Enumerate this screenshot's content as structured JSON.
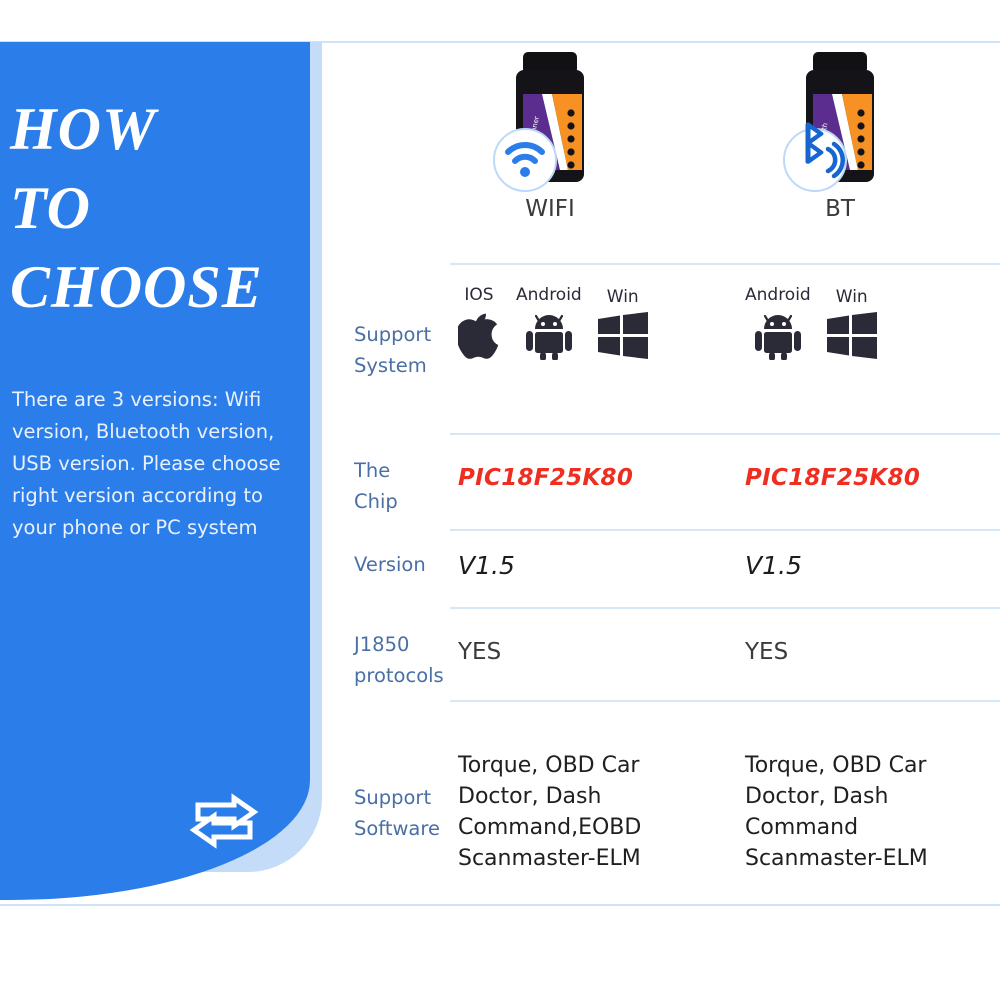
{
  "hero": {
    "title_lines": [
      "HOW",
      "TO",
      "CHOOSE"
    ],
    "title": "HOW TO CHOOSE",
    "body": "There are 3 versions: Wifi version, Bluetooth version, USB version. Please choose right version according to your phone or PC system",
    "icon": "exchange-arrows-icon",
    "bg_color": "#2b7de9",
    "shadow_color": "#c5dcf8",
    "title_color": "#ffffff",
    "body_color": "#e9f1fd"
  },
  "table": {
    "divider_color": "#d6e7f8",
    "label_color": "#4a6fa5",
    "products": [
      {
        "label": "WIFI",
        "badge_icon": "wifi-icon"
      },
      {
        "label": "BT",
        "badge_icon": "bluetooth-icon"
      }
    ],
    "rows": [
      {
        "label_lines": [
          "Support",
          "System"
        ],
        "label": "Support System",
        "type": "os",
        "values": [
          {
            "systems": [
              {
                "name": "IOS",
                "icon": "apple-icon"
              },
              {
                "name": "Android",
                "icon": "android-icon"
              },
              {
                "name": "Win",
                "icon": "windows-icon"
              }
            ]
          },
          {
            "systems": [
              {
                "name": "Android",
                "icon": "android-icon"
              },
              {
                "name": "Win",
                "icon": "windows-icon"
              }
            ]
          }
        ]
      },
      {
        "label_lines": [
          "The",
          "Chip"
        ],
        "label": "The Chip",
        "type": "chip",
        "values": [
          "PIC18F25K80",
          "PIC18F25K80"
        ],
        "value_color": "#ef2e22"
      },
      {
        "label_lines": [
          "Version"
        ],
        "label": "Version",
        "type": "version",
        "values": [
          "V1.5",
          "V1.5"
        ]
      },
      {
        "label_lines": [
          "J1850",
          "protocols"
        ],
        "label": "J1850 protocols",
        "type": "yesno",
        "values": [
          "YES",
          "YES"
        ]
      },
      {
        "label_lines": [
          "Support",
          "Software"
        ],
        "label": "Support Software",
        "type": "software",
        "values": [
          [
            "Torque, OBD Car",
            "Doctor, Dash",
            "Command,EOBD",
            "Scanmaster-ELM"
          ],
          [
            "Torque, OBD Car",
            "Doctor, Dash",
            "Command",
            "Scanmaster-ELM"
          ]
        ]
      }
    ]
  }
}
